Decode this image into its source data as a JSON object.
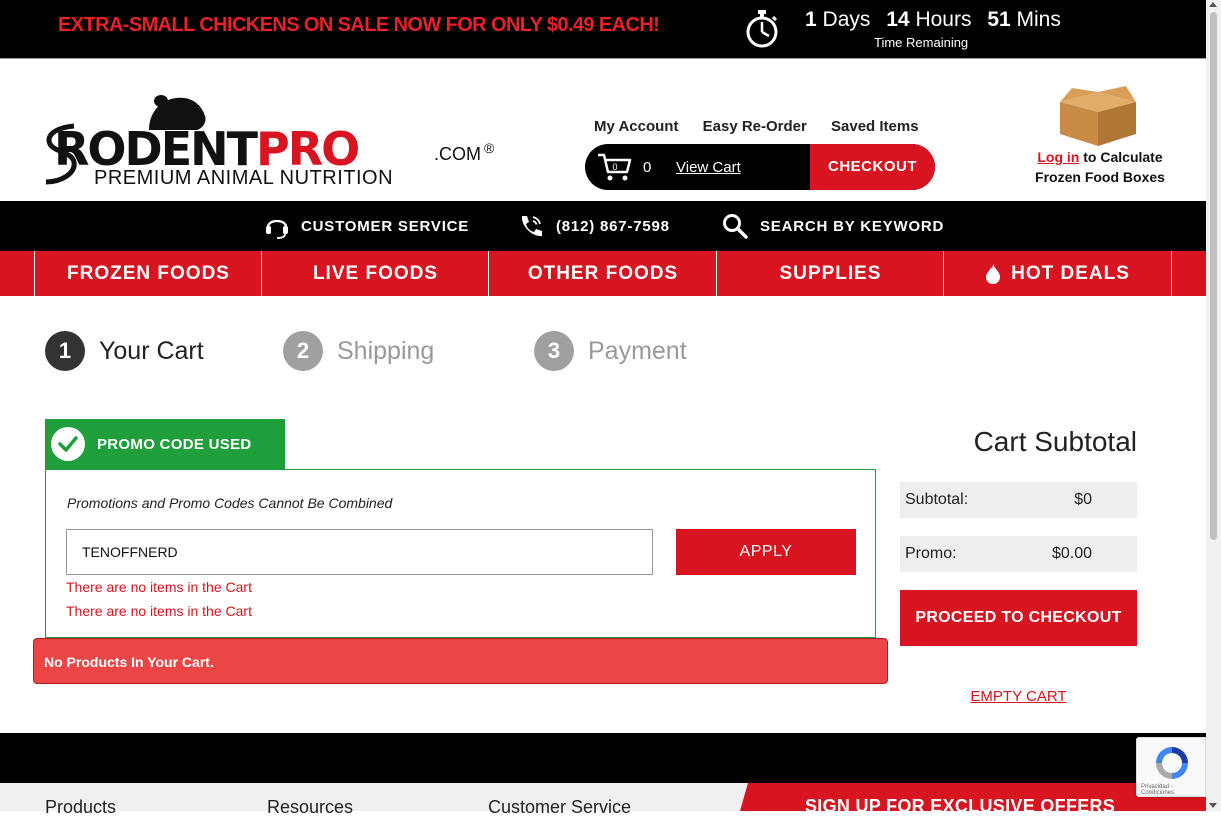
{
  "topbar": {
    "promo": "EXTRA-SMALL CHICKENS ON SALE NOW FOR ONLY $0.49 EACH!",
    "days_num": "1",
    "days_label": "Days",
    "hours_num": "14",
    "hours_label": "Hours",
    "mins_num": "51",
    "mins_label": "Mins",
    "remaining": "Time Remaining"
  },
  "logo": {
    "rodent": "RODENT",
    "pro": "PRO",
    "dotcom": ".COM",
    "reg": "®",
    "tagline": "PREMIUM ANIMAL NUTRITION"
  },
  "header": {
    "my_account": "My Account",
    "easy_reorder": "Easy Re-Order",
    "saved_items": "Saved Items",
    "cart_icon_count": "0",
    "cart_count": "0",
    "view_cart": "View Cart",
    "checkout": "CHECKOUT",
    "login": "Log in",
    "calc_text": " to Calculate",
    "calc_text2": "Frozen Food Boxes"
  },
  "utilbar": {
    "customer_service": "CUSTOMER SERVICE",
    "phone": "(812) 867-7598",
    "search": "SEARCH BY KEYWORD"
  },
  "nav": {
    "frozen": "FROZEN FOODS",
    "live": "LIVE FOODS",
    "other": "OTHER FOODS",
    "supplies": "SUPPLIES",
    "hot": "HOT DEALS"
  },
  "steps": [
    {
      "num": "1",
      "label": "Your Cart"
    },
    {
      "num": "2",
      "label": "Shipping"
    },
    {
      "num": "3",
      "label": "Payment"
    }
  ],
  "promo": {
    "tab_label": "PROMO CODE USED",
    "note": "Promotions and Promo Codes Cannot Be Combined",
    "code_value": "TENOFFNERD",
    "apply": "APPLY",
    "error1": "There are no items in the Cart",
    "error2": "There are no items in the Cart",
    "alert": "No Products In Your Cart."
  },
  "summary": {
    "title": "Cart Subtotal",
    "subtotal_label": "Subtotal:",
    "subtotal_value": "$0",
    "promo_label": "Promo:",
    "promo_value": "$0.00",
    "proceed": "PROCEED TO CHECKOUT",
    "empty": "EMPTY CART"
  },
  "footer": {
    "products": "Products",
    "resources": "Resources",
    "customer_service": "Customer Service",
    "signup": "SIGN UP FOR EXCLUSIVE OFFERS"
  },
  "recaptcha": {
    "label": "Privacidad - Condiciones"
  },
  "colors": {
    "brand_red": "#d7141f",
    "promo_green": "#1e9f3c",
    "alert_red": "#ec4545",
    "black": "#000000"
  },
  "icons": [
    "stopwatch-icon",
    "cart-icon",
    "headset-icon",
    "phone-icon",
    "search-icon",
    "flame-icon",
    "checkmark-icon",
    "box-icon",
    "recaptcha-icon"
  ]
}
